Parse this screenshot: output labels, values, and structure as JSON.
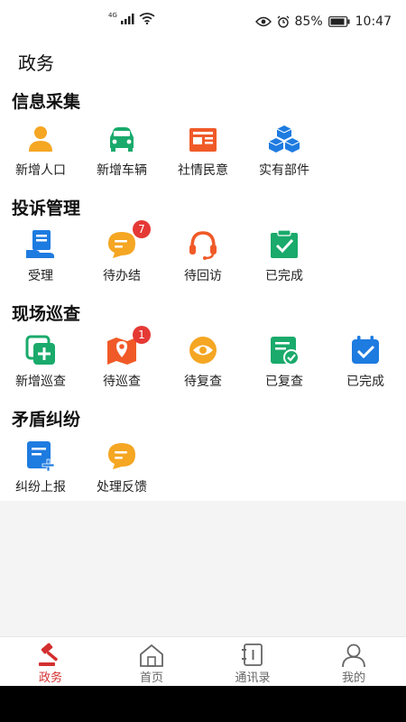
{
  "status_bar": {
    "signal": "4G",
    "battery": "85%",
    "time": "10:47"
  },
  "header": {
    "title": "政务"
  },
  "sections": [
    {
      "title": "信息采集",
      "items": [
        {
          "label": "新增人口",
          "icon": "person-icon"
        },
        {
          "label": "新增车辆",
          "icon": "car-icon"
        },
        {
          "label": "社情民意",
          "icon": "newspaper-icon"
        },
        {
          "label": "实有部件",
          "icon": "cubes-icon"
        }
      ]
    },
    {
      "title": "投诉管理",
      "items": [
        {
          "label": "受理",
          "icon": "accept-icon"
        },
        {
          "label": "待办结",
          "icon": "chat-icon",
          "badge": "7"
        },
        {
          "label": "待回访",
          "icon": "headset-icon"
        },
        {
          "label": "已完成",
          "icon": "clipboard-check-icon"
        }
      ]
    },
    {
      "title": "现场巡查",
      "items": [
        {
          "label": "新增巡查",
          "icon": "add-patrol-icon"
        },
        {
          "label": "待巡查",
          "icon": "map-pin-icon",
          "badge": "1"
        },
        {
          "label": "待复查",
          "icon": "eye-icon"
        },
        {
          "label": "已复查",
          "icon": "checklist-icon"
        },
        {
          "label": "已完成",
          "icon": "calendar-check-icon"
        }
      ]
    },
    {
      "title": "矛盾纠纷",
      "items": [
        {
          "label": "纠纷上报",
          "icon": "report-add-icon"
        },
        {
          "label": "处理反馈",
          "icon": "feedback-icon"
        }
      ]
    }
  ],
  "tabs": [
    {
      "label": "政务",
      "icon": "gavel-icon",
      "active": true
    },
    {
      "label": "首页",
      "icon": "home-icon",
      "active": false
    },
    {
      "label": "通讯录",
      "icon": "contacts-icon",
      "active": false
    },
    {
      "label": "我的",
      "icon": "user-icon",
      "active": false
    }
  ],
  "colors": {
    "orange": "#f5a623",
    "green": "#1aaa6b",
    "red_orange": "#f05a28",
    "blue": "#1e7be0",
    "active_red": "#d32f2f"
  }
}
